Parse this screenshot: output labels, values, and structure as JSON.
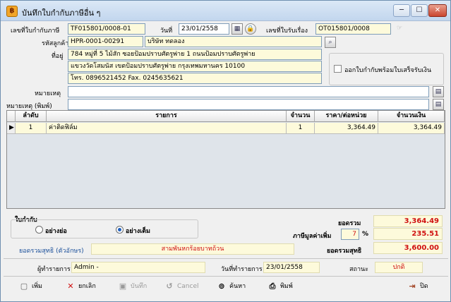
{
  "window": {
    "title": "บันทึกใบกำกับภาษีอื่น ๆ",
    "app_icon_glyph": "฿",
    "controls": [
      "─",
      "☐",
      "✕"
    ]
  },
  "header": {
    "invoice_no_label": "เลขที่ใบกำกับภาษี",
    "invoice_no": "TF015801/0008-01",
    "date_label": "วันที่",
    "date": "23/01/2558",
    "receipt_no_label": "เลขที่ใบรับเรื่อง",
    "receipt_no": "OT015801/0008",
    "customer_code_label": "รหัสลูกค้า",
    "customer_code": "HPR-0001-00291",
    "customer_name": "บริษัท ทดลอง",
    "address_label": "ที่อยู่",
    "address_lines": [
      "784 หมู่ที่ 5 ไม้สัก ซอยป้อมปราบศัตรูพ่าย 1 ถนนป้อมปราบศัตรูพ่าย",
      "แขวงวัดโสมนัส เขตป้อมปราบศัตรูพ่าย กรุงเทพมหานคร 10100",
      "โทร. 0896521452 Fax. 0245635621"
    ],
    "receipt_checkbox_label": "ออกใบกำกับพร้อมใบเสร็จรับเงิน",
    "receipt_checkbox_checked": false,
    "note_label": "หมายเหตุ",
    "note": "",
    "note_print_label": "หมายเหตุ (พิมพ์)",
    "note_print": ""
  },
  "grid": {
    "columns": [
      "ลำดับ",
      "รายการ",
      "จำนวน",
      "ราคา/ต่อหน่วย",
      "จำนวนเงิน"
    ],
    "rows": [
      {
        "no": "1",
        "item": "ค่าติดฟิล์ม",
        "qty": "1",
        "price": "3,364.49",
        "amount": "3,364.49"
      }
    ],
    "row_indicator": "▶"
  },
  "invoice_type": {
    "group_label": "ใบกำกับ",
    "option_short": "อย่างย่อ",
    "option_full": "อย่างเต็ม",
    "selected": "full"
  },
  "totals": {
    "total_label": "ยอดรวม",
    "total": "3,364.49",
    "vat_label": "ภาษีมูลค่าเพิ่ม",
    "vat_rate": "7",
    "vat_pct_sign": "%",
    "vat": "235.51",
    "net_label": "ยอดรวมสุทธิ",
    "net": "3,600.00",
    "net_text_label": "ยอดรวมสุทธิ (ตัวอักษร)",
    "net_text": "สามพันหกร้อยบาทถ้วน"
  },
  "footer_info": {
    "creator_label": "ผู้ทำรายการ",
    "creator": "Admin -",
    "created_date_label": "วันที่ทำรายการ",
    "created_date": "23/01/2558",
    "status_label": "สถานะ",
    "status": "ปกติ"
  },
  "toolbar": {
    "add": "เพิ่ม",
    "cancel_doc": "ยกเลิก",
    "save": "บันทึก",
    "cancel": "Cancel",
    "search": "ค้นหา",
    "print": "พิมพ์",
    "close": "ปิด"
  },
  "colors": {
    "yellow_field": "#fdfadb",
    "amount_red": "#d01010",
    "net_text_red": "#d01010",
    "label_blue": "#1a4f9a"
  }
}
